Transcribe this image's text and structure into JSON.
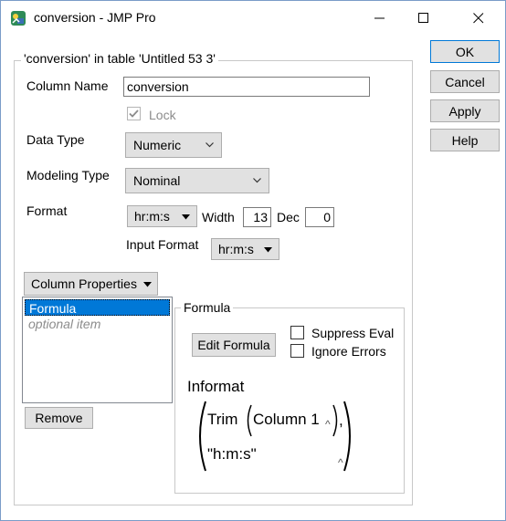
{
  "window": {
    "title": "conversion - JMP Pro",
    "controls": [
      "minimize",
      "maximize",
      "close"
    ]
  },
  "column_group": {
    "label": "'conversion' in table 'Untitled 53 3'"
  },
  "column_name": {
    "label": "Column Name",
    "value": "conversion"
  },
  "lock": {
    "label": "Lock",
    "checked": true,
    "enabled": false
  },
  "data_type": {
    "label": "Data Type",
    "value": "Numeric"
  },
  "modeling_type": {
    "label": "Modeling Type",
    "value": "Nominal"
  },
  "format": {
    "label": "Format",
    "value": "hr:m:s",
    "width_label": "Width",
    "width_value": "13",
    "dec_label": "Dec",
    "dec_value": "0"
  },
  "input_format": {
    "label": "Input Format",
    "value": "hr:m:s"
  },
  "column_properties": {
    "label": "Column Properties",
    "items": [
      {
        "label": "Formula",
        "selected": true
      },
      {
        "label": "optional item",
        "selected": false
      }
    ],
    "remove_label": "Remove"
  },
  "formula_panel": {
    "label": "Formula",
    "edit_label": "Edit Formula",
    "suppress_eval_label": "Suppress Eval",
    "ignore_errors_label": "Ignore Errors",
    "suppress_eval_checked": false,
    "ignore_errors_checked": false,
    "expr": {
      "func": "Informat",
      "inner_func": "Trim",
      "arg": "Column 1",
      "comma": ",",
      "format_str": "\"h:m:s\""
    }
  },
  "actions": {
    "ok": "OK",
    "cancel": "Cancel",
    "apply": "Apply",
    "help": "Help"
  },
  "colors": {
    "accent": "#0078d7",
    "button_face": "#e1e1e1",
    "button_border": "#adadad",
    "group_border": "#c8c8c8",
    "disabled_text": "#8c8c8c"
  }
}
